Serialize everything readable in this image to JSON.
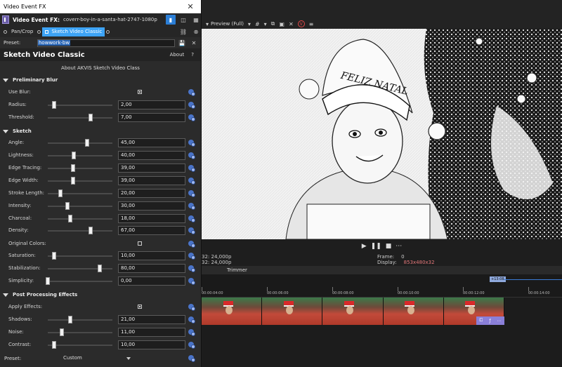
{
  "fx_window": {
    "title": "Video Event FX",
    "header_label": "Video Event FX:",
    "header_value": "coverr-boy-in-a-santa-hat-2747-1080p",
    "chain": [
      "Pan/Crop",
      "Sketch Video Classic"
    ],
    "preset_label": "Preset:",
    "preset_value": "howwork-bw"
  },
  "plugin": {
    "title": "Sketch Video Classic",
    "about_label": "About",
    "help_label": "?",
    "about_plugin_label": "About AKVIS Sketch Video Class"
  },
  "sections": {
    "blur": "Preliminary Blur",
    "sketch": "Sketch",
    "post": "Post Processing Effects"
  },
  "params": {
    "use_blur": {
      "label": "Use Blur:",
      "checked": true
    },
    "radius": {
      "label": "Radius:",
      "value": "2,00",
      "slider": 0.1
    },
    "threshold": {
      "label": "Threshold:",
      "value": "7,00",
      "slider": 0.66
    },
    "angle": {
      "label": "Angle:",
      "value": "45,00",
      "slider": 0.61
    },
    "lightness": {
      "label": "Lightness:",
      "value": "40,00",
      "slider": 0.4
    },
    "edge_tracing": {
      "label": "Edge Tracing:",
      "value": "39,00",
      "slider": 0.39
    },
    "edge_width": {
      "label": "Edge Width:",
      "value": "39,00",
      "slider": 0.39
    },
    "stroke_length": {
      "label": "Stroke Length:",
      "value": "20,00",
      "slider": 0.2
    },
    "intensity": {
      "label": "Intensity:",
      "value": "30,00",
      "slider": 0.3
    },
    "charcoal": {
      "label": "Charcoal:",
      "value": "18,00",
      "slider": 0.35
    },
    "density": {
      "label": "Density:",
      "value": "67,00",
      "slider": 0.66
    },
    "original_colors": {
      "label": "Original Colors:",
      "checked": false
    },
    "saturation": {
      "label": "Saturation:",
      "value": "10,00",
      "slider": 0.1
    },
    "stabilization": {
      "label": "Stabilization:",
      "value": "80,00",
      "slider": 0.8
    },
    "simplicity": {
      "label": "Simplicity:",
      "value": "0,00",
      "slider": 0.0
    },
    "apply_effects": {
      "label": "Apply Effects:",
      "checked": true
    },
    "shadows": {
      "label": "Shadows:",
      "value": "21,00",
      "slider": 0.35
    },
    "noise": {
      "label": "Noise:",
      "value": "11,00",
      "slider": 0.22
    },
    "contrast": {
      "label": "Contrast:",
      "value": "10,00",
      "slider": 0.1
    }
  },
  "bottom_preset": {
    "label": "Preset:",
    "value": "Custom"
  },
  "preview": {
    "toolbar_label": "Preview (Full)",
    "left_info_1": "32: 24,000p",
    "left_info_2": "32: 24,000p",
    "frame_label": "Frame:",
    "frame_value": "0",
    "display_label": "Display:",
    "display_value": "853x480x32",
    "trimmer_label": "Trimmer",
    "hat_text": "FELIZ NATAL"
  },
  "timeline": {
    "time_badge": "+13:08",
    "ticks": [
      "00:00:04:00",
      "00:00:06:00",
      "00:00:08:00",
      "00:00:10:00",
      "00:00:12:00",
      "00:00:14:00"
    ],
    "clip_count": 5
  },
  "colors": {
    "accent": "#2c7fd7",
    "chain_selected": "#3da3f5",
    "keyframe": "#4a74c9",
    "display_value": "#e4787a"
  }
}
